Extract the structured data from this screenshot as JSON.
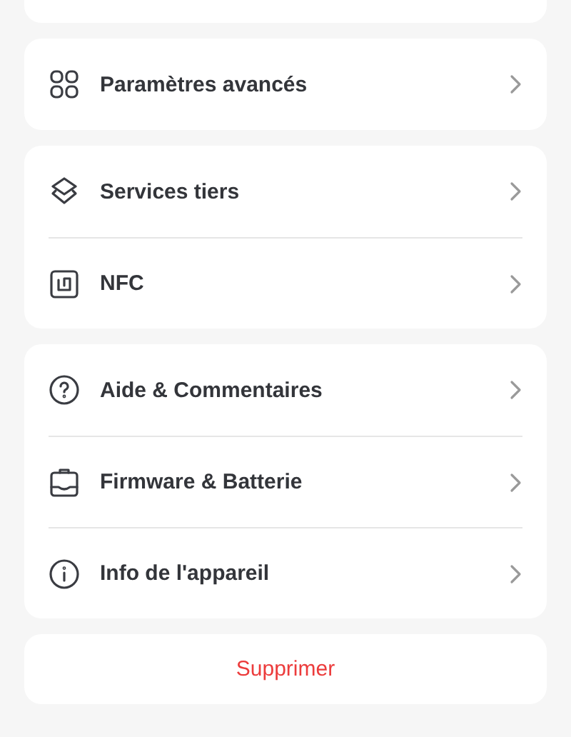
{
  "groups": [
    {
      "items": [
        {
          "kind": "grid",
          "label": "Paramètres avancés"
        }
      ]
    },
    {
      "items": [
        {
          "kind": "layers",
          "label": "Services tiers"
        },
        {
          "kind": "nfc",
          "label": "NFC"
        }
      ]
    },
    {
      "items": [
        {
          "kind": "help",
          "label": "Aide & Commentaires"
        },
        {
          "kind": "firmware",
          "label": "Firmware & Batterie"
        },
        {
          "kind": "info",
          "label": "Info de l'appareil"
        }
      ]
    }
  ],
  "delete_button": {
    "label": "Supprimer"
  }
}
